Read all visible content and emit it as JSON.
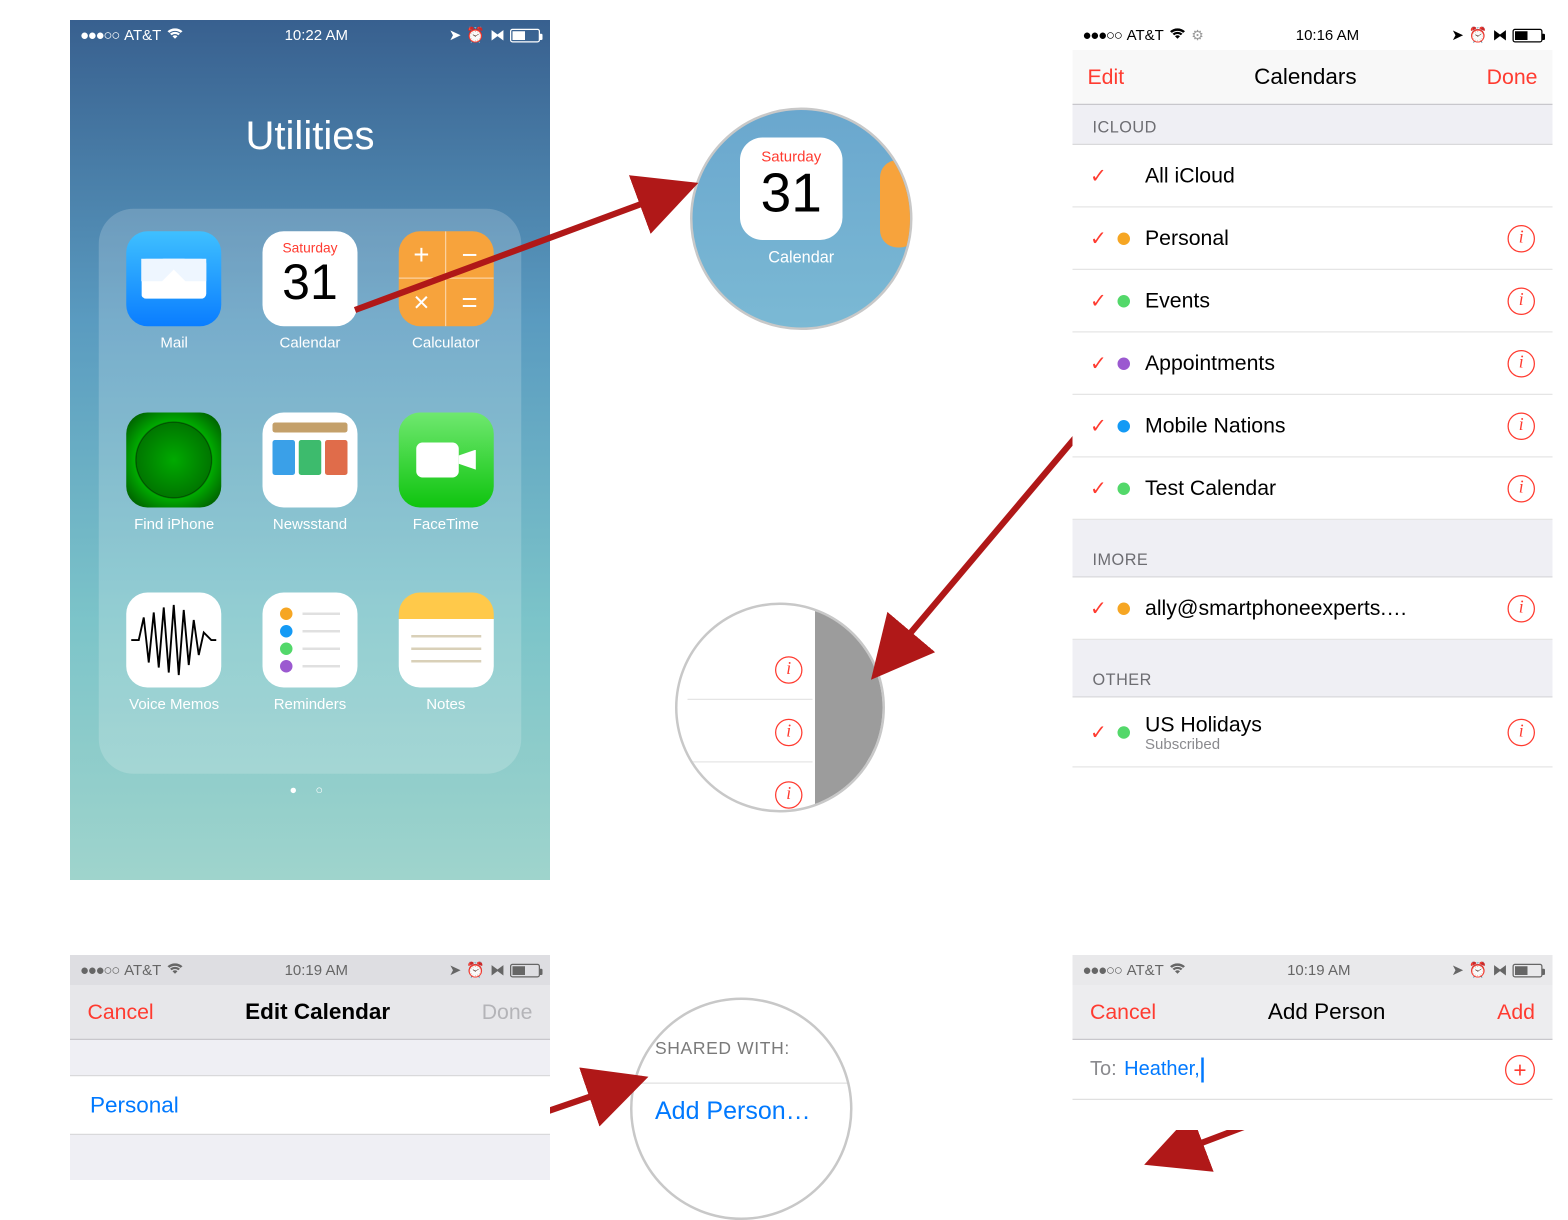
{
  "p1": {
    "status": {
      "carrier": "AT&T",
      "time": "10:22 AM"
    },
    "folder_title": "Utilities",
    "cal_dow": "Saturday",
    "cal_day": "31",
    "apps": {
      "mail": "Mail",
      "calendar": "Calendar",
      "calculator": "Calculator",
      "find": "Find iPhone",
      "news": "Newsstand",
      "facetime": "FaceTime",
      "voice": "Voice Memos",
      "reminders": "Reminders",
      "notes": "Notes"
    }
  },
  "circle_cal": {
    "dow": "Saturday",
    "day": "31",
    "label": "Calendar"
  },
  "circle_share": {
    "header": "SHARED WITH:",
    "link": "Add Person…"
  },
  "p2": {
    "status": {
      "carrier": "AT&T",
      "time": "10:16 AM"
    },
    "nav": {
      "left": "Edit",
      "title": "Calendars",
      "right": "Done"
    },
    "sec_icloud": "ICLOUD",
    "sec_imore": "IMORE",
    "sec_other": "OTHER",
    "rows": {
      "all": "All iCloud",
      "personal": "Personal",
      "events": "Events",
      "appts": "Appointments",
      "mobile": "Mobile Nations",
      "test": "Test Calendar",
      "ally": "ally@smartphoneexperts.…",
      "holidays": "US Holidays",
      "holidays_sub": "Subscribed"
    },
    "dots": {
      "personal": "#f6a623",
      "events": "#53d86a",
      "appts": "#9b59d0",
      "mobile": "#149af5",
      "test": "#53d86a",
      "ally": "#f6a623",
      "holidays": "#53d86a"
    }
  },
  "p3": {
    "status": {
      "carrier": "AT&T",
      "time": "10:19 AM"
    },
    "nav": {
      "left": "Cancel",
      "title": "Edit Calendar",
      "right": "Done"
    },
    "field": "Personal"
  },
  "p4": {
    "status": {
      "carrier": "AT&T",
      "time": "10:19 AM"
    },
    "nav": {
      "left": "Cancel",
      "title": "Add Person",
      "right": "Add"
    },
    "to_label": "To:",
    "to_value": "Heather,"
  }
}
